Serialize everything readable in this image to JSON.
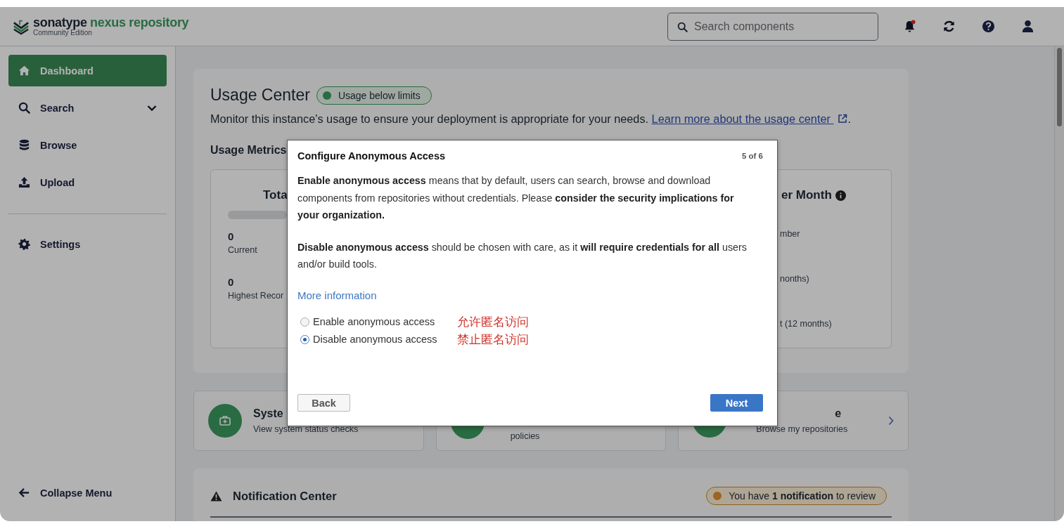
{
  "header": {
    "brand": "sonatype",
    "product": "nexus repository",
    "edition": "Community Edition",
    "search": {
      "placeholder": "Search components"
    },
    "notifications_unread": true
  },
  "sidebar": {
    "groups": [
      [
        {
          "kind": "home",
          "label": "Dashboard",
          "selected": true
        },
        {
          "kind": "search",
          "label": "Search",
          "selected": false,
          "expanded": false
        },
        {
          "kind": "database",
          "label": "Browse",
          "selected": false
        },
        {
          "kind": "upload",
          "label": "Upload",
          "selected": false
        }
      ],
      [
        {
          "kind": "gear",
          "label": "Settings",
          "selected": false
        }
      ]
    ],
    "collapse": "Collapse Menu"
  },
  "usage_center": {
    "title": "Usage Center",
    "status": "Usage below limits",
    "description": "Monitor this instance's usage to ensure your deployment is appropriate for your needs.",
    "link": "Learn more about the usage center",
    "link_suffix": ".",
    "metrics_title": "Usage Metrics",
    "left_card": {
      "title": "Tota",
      "stats": [
        {
          "value": "0",
          "label": "Current"
        },
        {
          "value": "0",
          "label": "Highest Recor"
        }
      ]
    },
    "right_card": {
      "title": "er Month",
      "rows": [
        "mber",
        "nonths)",
        "t (12 months)"
      ]
    }
  },
  "action_cards": [
    {
      "title": "Syste",
      "subtitle": "View system status checks"
    },
    {
      "subtitle": "policies"
    },
    {
      "title": "e",
      "subtitle": "Browse my repositories",
      "chevron": true
    }
  ],
  "notification_center": {
    "title": "Notification Center",
    "badge": "You have **1 notification** to review"
  },
  "modal": {
    "title": "Configure Anonymous Access",
    "step": "5 of 6",
    "paragraphs": [
      "**Enable anonymous access** means that by default, users can search, browse and download components from repositories without credentials. Please **consider the security implications for your organization.**",
      "**Disable anonymous access** should be chosen with care, as it **will require credentials for all** users and/or build tools."
    ],
    "link": "More information",
    "options": [
      {
        "label": "Enable anonymous access",
        "selected": false,
        "note": "允许匿名访问"
      },
      {
        "label": "Disable anonymous access",
        "selected": true,
        "note": "禁止匿名访问"
      }
    ],
    "back": "Back",
    "next": "Next"
  }
}
